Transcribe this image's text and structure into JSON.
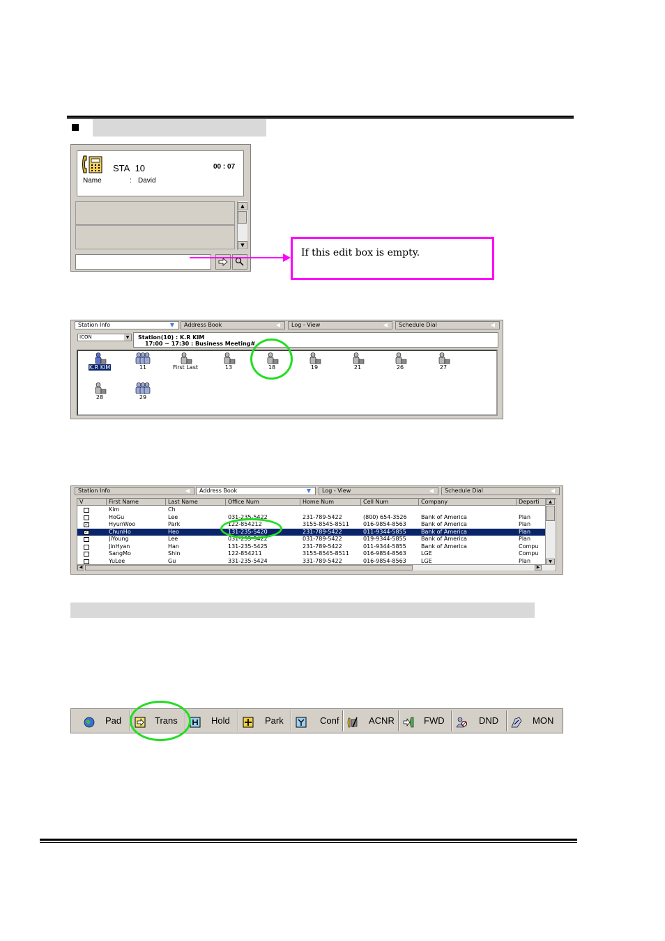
{
  "call_panel": {
    "station_label": "STA",
    "station_number": "10",
    "timer": "00 : 07",
    "name_label": "Name",
    "name_colon": ":",
    "name_value": "David",
    "edit_value": "",
    "dial_icon": "arrow-right-icon",
    "search_icon": "magnifier-icon"
  },
  "callout": {
    "text": "If this edit box is empty."
  },
  "tabs": {
    "station_info": "Station Info",
    "address_book": "Address Book",
    "log_view": "Log - View",
    "schedule_dial": "Schedule Dial"
  },
  "station_view": {
    "view_mode": "ICON",
    "info_line1": "Station(10) :  K.R KIM",
    "info_line2": "17:00 ~ 17:30 : Business Meeting#",
    "stations": [
      {
        "label": "K.R KIM",
        "selected": true,
        "type": "single"
      },
      {
        "label": "11",
        "selected": false,
        "type": "group"
      },
      {
        "label": "First Last",
        "selected": false,
        "type": "single"
      },
      {
        "label": "13",
        "selected": false,
        "type": "single"
      },
      {
        "label": "18",
        "selected": false,
        "type": "single"
      },
      {
        "label": "19",
        "selected": false,
        "type": "single"
      },
      {
        "label": "21",
        "selected": false,
        "type": "single"
      },
      {
        "label": "26",
        "selected": false,
        "type": "single"
      },
      {
        "label": "27",
        "selected": false,
        "type": "single"
      },
      {
        "label": "28",
        "selected": false,
        "type": "single"
      },
      {
        "label": "29",
        "selected": false,
        "type": "group"
      }
    ]
  },
  "address_book": {
    "columns": [
      "V",
      "First Name",
      "Last Name",
      "Office Num",
      "Home Num",
      "Cell Num",
      "Company",
      "Departi"
    ],
    "rows": [
      {
        "checked": false,
        "selected": false,
        "cells": [
          "Kim",
          "Ch",
          "",
          "",
          "",
          "",
          ""
        ]
      },
      {
        "checked": false,
        "selected": false,
        "cells": [
          "HoGu",
          "Lee",
          "031-235-5422",
          "231-789-5422",
          "(800) 654-3526",
          "Bank of America",
          "Plan"
        ]
      },
      {
        "checked": true,
        "selected": false,
        "cells": [
          "HyunWoo",
          "Park",
          "122-854212",
          "3155-8545-8511",
          "016-9854-8563",
          "Bank of America",
          "Plan"
        ]
      },
      {
        "checked": true,
        "selected": true,
        "cells": [
          "ChunHo",
          "Heo",
          "131-235-5420",
          "231-789-5422",
          "011-9344-5855",
          "Bank of America",
          "Plan"
        ]
      },
      {
        "checked": false,
        "selected": false,
        "cells": [
          "JiYoung",
          "Lee",
          "031-235-5422",
          "031-789-5422",
          "019-9344-5855",
          "Bank of America",
          "Plan"
        ]
      },
      {
        "checked": false,
        "selected": false,
        "cells": [
          "JinHyan",
          "Han",
          "131-235-5425",
          "231-789-5422",
          "011-9344-5855",
          "Bank of America",
          "Compu"
        ]
      },
      {
        "checked": false,
        "selected": false,
        "cells": [
          "SangMo",
          "Shin",
          "122-854211",
          "3155-8545-8511",
          "016-9854-8563",
          "LGE",
          "Compu"
        ]
      },
      {
        "checked": false,
        "selected": false,
        "cells": [
          "YuLee",
          "Gu",
          "331-235-5424",
          "331-789-5422",
          "016-9854-8563",
          "LGE",
          "Plan"
        ]
      }
    ]
  },
  "toolbar": {
    "buttons": [
      {
        "label": "Pad",
        "icon": "globe-icon"
      },
      {
        "label": "Trans",
        "icon": "transfer-icon"
      },
      {
        "label": "Hold",
        "icon": "hold-icon"
      },
      {
        "label": "Park",
        "icon": "park-icon"
      },
      {
        "label": "Conf",
        "icon": "conference-icon"
      },
      {
        "label": "ACNR",
        "icon": "acnr-icon"
      },
      {
        "label": "FWD",
        "icon": "forward-icon"
      },
      {
        "label": "DND",
        "icon": "dnd-icon"
      },
      {
        "label": "MON",
        "icon": "monitor-icon"
      }
    ]
  },
  "colors": {
    "callout_border": "#ff00ff",
    "highlight_ring": "#22dd22",
    "selection": "#0a246a",
    "window_face": "#d4d0c8"
  }
}
